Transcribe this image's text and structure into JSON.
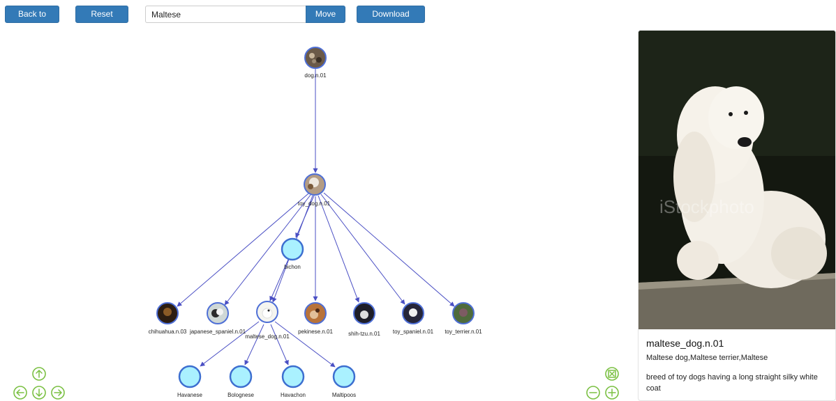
{
  "toolbar": {
    "back_label": "Back to root",
    "reset_label": "Reset graph",
    "search_value": "Maltese",
    "move_label": "Move to",
    "download_label": "Download image"
  },
  "graph": {
    "root": "dog.n.01",
    "parent": "toy_dog.n.01",
    "group": "bichon",
    "children": [
      "chihuahua.n.03",
      "japanese_spaniel.n.01",
      "maltese_dog.n.01",
      "pekinese.n.01",
      "shih-tzu.n.01",
      "toy_spaniel.n.01",
      "toy_terrier.n.01"
    ],
    "leaves": [
      "Havanese",
      "Bolognese",
      "Havachon",
      "Maltipoos"
    ],
    "photo_node_color": "#4e6fd6",
    "plain_node_fill": "#aaf1ff",
    "edge_color": "#4a4fc4"
  },
  "navigation": {
    "icons": [
      "arrow-up-icon",
      "arrow-left-icon",
      "arrow-down-icon",
      "arrow-right-icon",
      "zoom-fit-icon",
      "zoom-out-icon",
      "zoom-in-icon"
    ],
    "accent": "#7bc043"
  },
  "detail": {
    "watermark": "iStockphoto",
    "title": "maltese_dog.n.01",
    "synonyms": "Maltese dog,Maltese terrier,Maltese",
    "definition": "breed of toy dogs having a long straight silky white coat"
  }
}
